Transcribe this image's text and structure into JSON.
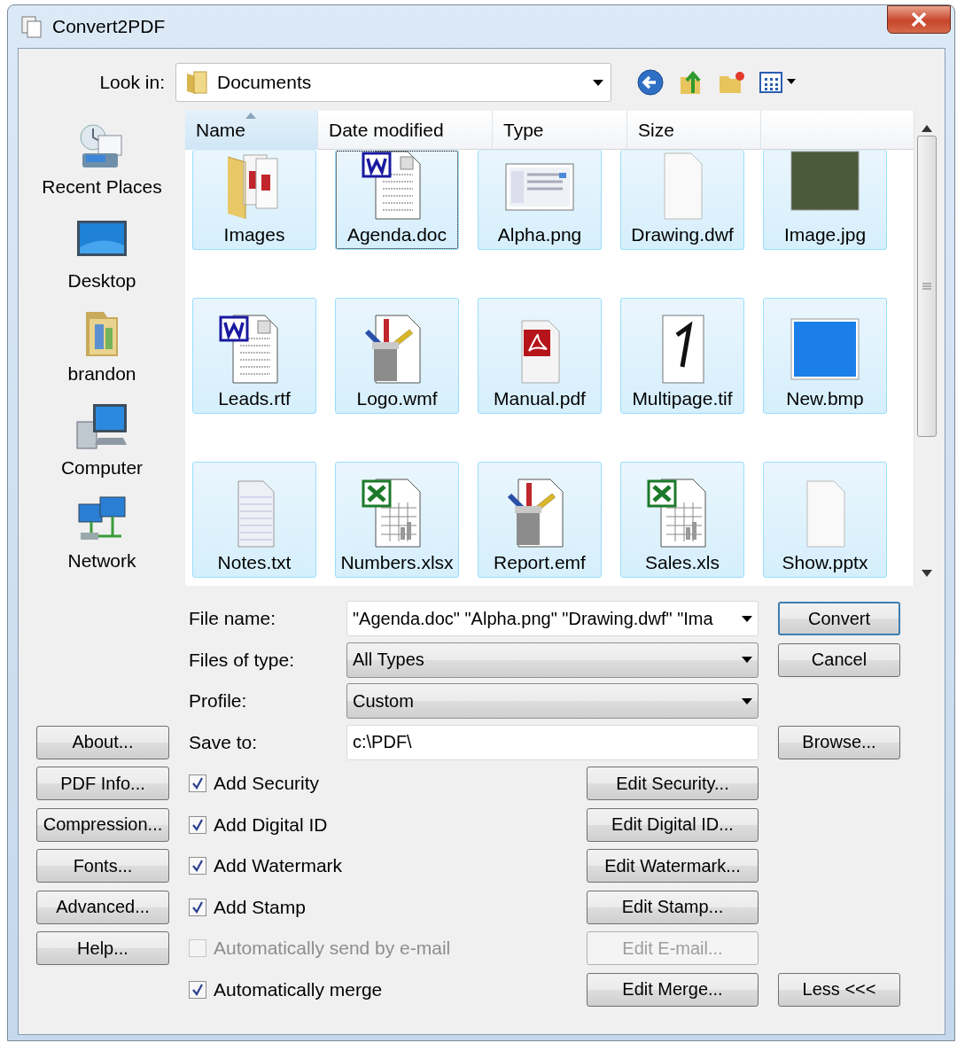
{
  "window": {
    "title": "Convert2PDF"
  },
  "look_in": {
    "label": "Look in:",
    "value": "Documents"
  },
  "places": [
    {
      "label": "Recent Places",
      "kind": "recent"
    },
    {
      "label": "Desktop",
      "kind": "desktop"
    },
    {
      "label": "brandon",
      "kind": "user"
    },
    {
      "label": "Computer",
      "kind": "computer"
    },
    {
      "label": "Network",
      "kind": "network"
    }
  ],
  "file_list": {
    "columns": [
      {
        "label": "Name",
        "sorted": true
      },
      {
        "label": "Date modified",
        "sorted": false
      },
      {
        "label": "Type",
        "sorted": false
      },
      {
        "label": "Size",
        "sorted": false
      }
    ],
    "items": [
      {
        "name": "Images",
        "kind": "folder",
        "selected": true,
        "focused": false
      },
      {
        "name": "Agenda.doc",
        "kind": "word",
        "selected": true,
        "focused": true
      },
      {
        "name": "Alpha.png",
        "kind": "screenshot",
        "selected": true,
        "focused": false
      },
      {
        "name": "Drawing.dwf",
        "kind": "blank",
        "selected": true,
        "focused": false
      },
      {
        "name": "Image.jpg",
        "kind": "photo",
        "selected": true,
        "focused": false
      },
      {
        "name": "Leads.rtf",
        "kind": "word",
        "selected": true,
        "focused": false
      },
      {
        "name": "Logo.wmf",
        "kind": "art",
        "selected": true,
        "focused": false
      },
      {
        "name": "Manual.pdf",
        "kind": "pdf",
        "selected": true,
        "focused": false
      },
      {
        "name": "Multipage.tif",
        "kind": "tif",
        "selected": true,
        "focused": false
      },
      {
        "name": "New.bmp",
        "kind": "bitmap",
        "selected": true,
        "focused": false
      },
      {
        "name": "Notes.txt",
        "kind": "text",
        "selected": true,
        "focused": false
      },
      {
        "name": "Numbers.xlsx",
        "kind": "excel",
        "selected": true,
        "focused": false
      },
      {
        "name": "Report.emf",
        "kind": "art",
        "selected": true,
        "focused": false
      },
      {
        "name": "Sales.xls",
        "kind": "excel",
        "selected": true,
        "focused": false
      },
      {
        "name": "Show.pptx",
        "kind": "blank",
        "selected": true,
        "focused": false
      }
    ]
  },
  "fields": [
    {
      "label": "File name:",
      "kind": "combo",
      "value": "\"Agenda.doc\" \"Alpha.png\" \"Drawing.dwf\" \"Ima"
    },
    {
      "label": "Files of type:",
      "kind": "dropdown",
      "value": "All Types"
    },
    {
      "label": "Profile:",
      "kind": "dropdown",
      "value": "Custom"
    },
    {
      "label": "Save to:",
      "kind": "text",
      "value": "c:\\PDF\\"
    }
  ],
  "options": [
    {
      "label": "Add Security",
      "checked": true,
      "disabled": false,
      "button": "Edit Security..."
    },
    {
      "label": "Add Digital ID",
      "checked": true,
      "disabled": false,
      "button": "Edit Digital ID..."
    },
    {
      "label": "Add Watermark",
      "checked": true,
      "disabled": false,
      "button": "Edit Watermark..."
    },
    {
      "label": "Add Stamp",
      "checked": true,
      "disabled": false,
      "button": "Edit Stamp..."
    },
    {
      "label": "Automatically send by e-mail",
      "checked": false,
      "disabled": true,
      "button": "Edit E-mail..."
    },
    {
      "label": "Automatically merge",
      "checked": true,
      "disabled": false,
      "button": "Edit Merge..."
    }
  ],
  "side_buttons": [
    "About...",
    "PDF Info...",
    "Compression...",
    "Fonts...",
    "Advanced...",
    "Help..."
  ],
  "dialog_buttons": [
    {
      "label": "Convert",
      "default": true
    },
    {
      "label": "Cancel",
      "default": false
    },
    {
      "label": "Browse...",
      "default": false
    },
    {
      "label": "Less <<<",
      "default": false
    }
  ]
}
